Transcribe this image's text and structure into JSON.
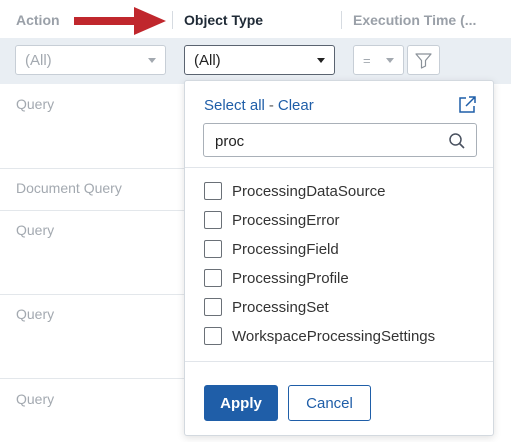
{
  "header": {
    "col_action": "Action",
    "col_object_type": "Object Type",
    "col_execution_time": "Execution Time (..."
  },
  "filters": {
    "action_value": "(All)",
    "object_type_value": "(All)",
    "operator_value": "="
  },
  "rows": [
    "Query",
    "Document Query",
    "Query",
    "Query",
    "Query"
  ],
  "dropdown": {
    "select_all": "Select all",
    "separator": "-",
    "clear": "Clear",
    "search_value": "proc",
    "options": [
      "ProcessingDataSource",
      "ProcessingError",
      "ProcessingField",
      "ProcessingProfile",
      "ProcessingSet",
      "WorkspaceProcessingSettings"
    ],
    "apply_label": "Apply",
    "cancel_label": "Cancel"
  },
  "colors": {
    "accent": "#1f5ea8",
    "annotation_arrow": "#c0272d",
    "filter_row_bg": "#e9eef3"
  },
  "icons": [
    "external-link-icon",
    "search-icon",
    "filter-icon",
    "chevron-down-icon",
    "red-arrow-annotation"
  ]
}
